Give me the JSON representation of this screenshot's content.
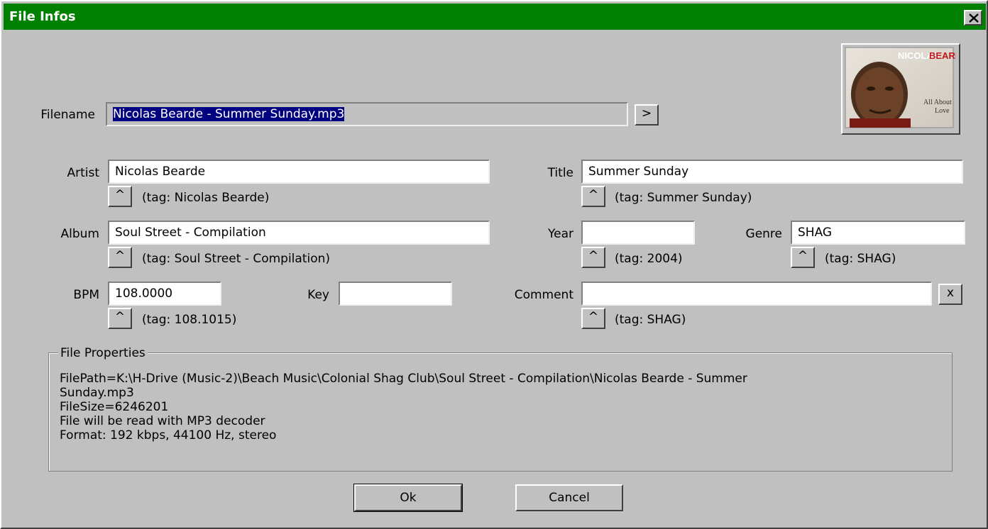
{
  "window": {
    "title": "File Infos"
  },
  "filename": {
    "label": "Filename",
    "value": "Nicolas Bearde - Summer Sunday.mp3",
    "browse_label": ">"
  },
  "cover": {
    "top_text_1": "NICOLAS",
    "top_text_2": "BEARDE",
    "caption_1": "All About",
    "caption_2": "Love"
  },
  "artist": {
    "label": "Artist",
    "value": "Nicolas Bearde",
    "tag": "(tag: Nicolas Bearde)"
  },
  "title": {
    "label": "Title",
    "value": "Summer Sunday",
    "tag": "(tag: Summer Sunday)"
  },
  "album": {
    "label": "Album",
    "value": "Soul Street - Compilation",
    "tag": "(tag: Soul Street - Compilation)"
  },
  "year": {
    "label": "Year",
    "value": "",
    "tag": "(tag: 2004)"
  },
  "genre": {
    "label": "Genre",
    "value": "SHAG",
    "tag": "(tag: SHAG)"
  },
  "bpm": {
    "label": "BPM",
    "value": "108.0000",
    "tag": "(tag: 108.1015)"
  },
  "key": {
    "label": "Key",
    "value": ""
  },
  "comment": {
    "label": "Comment",
    "value": "",
    "tag": "(tag: SHAG)",
    "clear_label": "x"
  },
  "copy_button_label": "^",
  "properties": {
    "title": "File Properties",
    "lines": [
      "FilePath=K:\\H-Drive (Music-2)\\Beach Music\\Colonial Shag Club\\Soul Street - Compilation\\Nicolas Bearde - Summer",
      "Sunday.mp3",
      "FileSize=6246201",
      "File will be read with MP3 decoder",
      "Format: 192 kbps, 44100 Hz, stereo"
    ]
  },
  "buttons": {
    "ok": "Ok",
    "cancel": "Cancel"
  },
  "colors": {
    "titlebar": "#008000",
    "dialog": "#c0c0c0",
    "selection": "#000080"
  }
}
